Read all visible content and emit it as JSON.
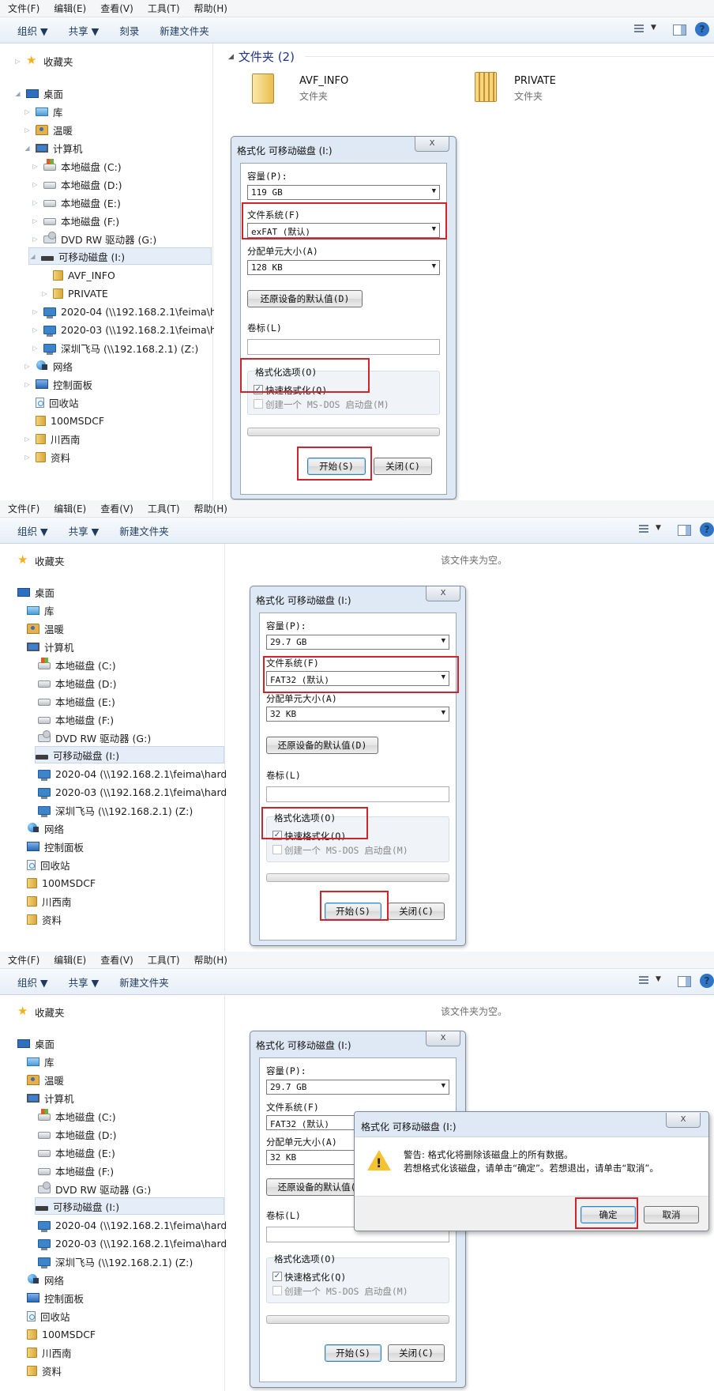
{
  "menu": [
    "文件(F)",
    "编辑(E)",
    "查看(V)",
    "工具(T)",
    "帮助(H)"
  ],
  "toolbar_p1": [
    "组织 ▼",
    "共享 ▼",
    "刻录",
    "新建文件夹"
  ],
  "toolbar_p2": [
    "组织 ▼",
    "共享 ▼",
    "新建文件夹"
  ],
  "nav": {
    "favorites": "收藏夹",
    "desktop": "桌面",
    "library": "库",
    "user": "温暖",
    "computer": "计算机",
    "disk_c": "本地磁盘 (C:)",
    "disk_d": "本地磁盘 (D:)",
    "disk_e": "本地磁盘 (E:)",
    "disk_f": "本地磁盘 (F:)",
    "dvd": "DVD RW 驱动器 (G:)",
    "removable": "可移动磁盘 (I:)",
    "avf": "AVF_INFO",
    "private": "PRIVATE",
    "net1_p1": "2020-04 (\\\\192.168.2.1\\feima\\hardw",
    "net2_p1": "2020-03 (\\\\192.168.2.1\\feima\\hardw",
    "net1": "2020-04 (\\\\192.168.2.1\\feima\\hardwa",
    "net2": "2020-03 (\\\\192.168.2.1\\feima\\hardwa",
    "net3": "深圳飞马 (\\\\192.168.2.1) (Z:)",
    "network": "网络",
    "control_panel": "控制面板",
    "recycle": "回收站",
    "f100": "100MSDCF",
    "chuanxinan": "川西南",
    "ziliao": "资料"
  },
  "content_p1": {
    "group_header": "文件夹 (2)",
    "folders": [
      {
        "name": "AVF_INFO",
        "type": "文件夹"
      },
      {
        "name": "PRIVATE",
        "type": "文件夹"
      }
    ]
  },
  "empty_text": "该文件夹为空。",
  "format_dialog": {
    "title": "格式化 可移动磁盘 (I:)",
    "close": "X",
    "capacity_label": "容量(P):",
    "fs_label": "文件系统(F)",
    "alloc_label": "分配单元大小(A)",
    "restore_button": "还原设备的默认值(D)",
    "volume_label": "卷标(L)",
    "options_label": "格式化选项(O)",
    "quick_format": "快速格式化(Q)",
    "msdos_disk": "创建一个 MS-DOS 启动盘(M)",
    "start_button": "开始(S)",
    "close_button": "关闭(C)"
  },
  "p1_values": {
    "capacity": "119 GB",
    "filesystem": "exFAT (默认)",
    "alloc": "128 KB"
  },
  "p2_values": {
    "capacity": "29.7 GB",
    "filesystem": "FAT32 (默认)",
    "alloc": "32 KB"
  },
  "warning_dialog": {
    "title": "格式化 可移动磁盘 (I:)",
    "line1": "警告: 格式化将删除该磁盘上的所有数据。",
    "line2": "若想格式化该磁盘，请单击“确定”。若想退出，请单击“取消”。",
    "ok": "确定",
    "cancel": "取消"
  },
  "colors": {
    "highlight": "#d0232a",
    "dialog_frame": "#dfe9f5",
    "nav_selected": "#e5eef8"
  }
}
